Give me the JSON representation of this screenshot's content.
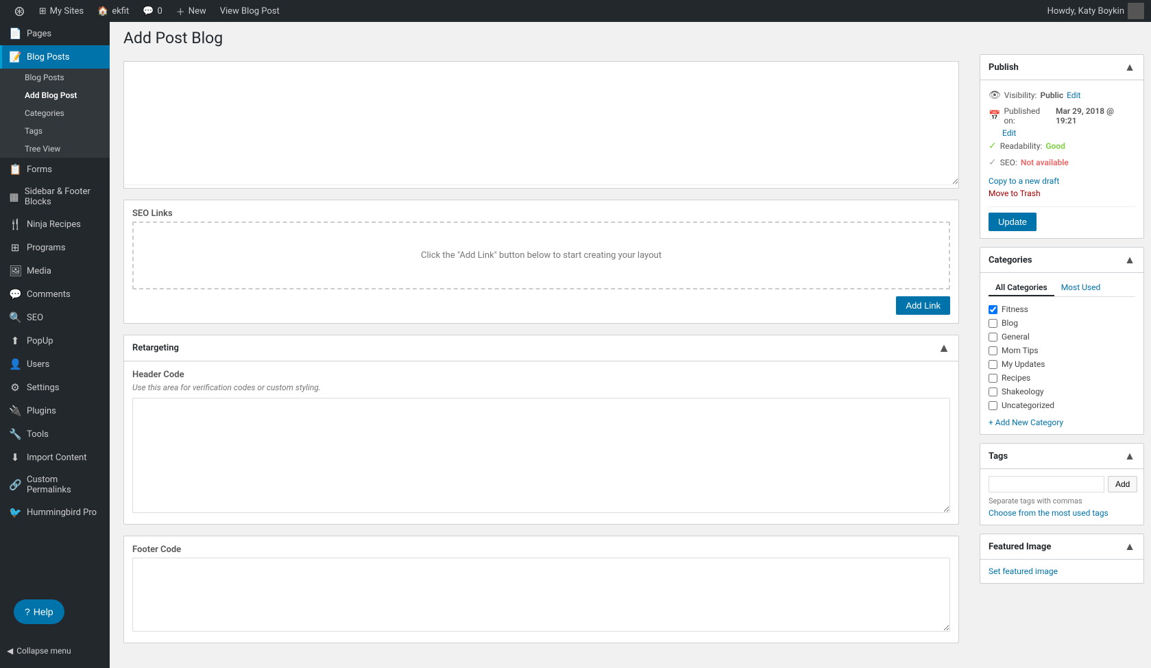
{
  "adminbar": {
    "wp_icon": "⊕",
    "sites_label": "My Sites",
    "site_name": "ekfit",
    "comments_icon": "💬",
    "comments_count": "0",
    "new_label": "New",
    "view_label": "View Blog Post",
    "howdy": "Howdy, Katy Boykin"
  },
  "sidebar": {
    "items": [
      {
        "id": "pages",
        "label": "Pages",
        "icon": "📄"
      },
      {
        "id": "blog-posts",
        "label": "Blog Posts",
        "icon": "📝",
        "active": true
      },
      {
        "id": "forms",
        "label": "Forms",
        "icon": "📋"
      },
      {
        "id": "sidebar-footer",
        "label": "Sidebar & Footer Blocks",
        "icon": "▦"
      },
      {
        "id": "ninja-recipes",
        "label": "Ninja Recipes",
        "icon": "🍴"
      },
      {
        "id": "programs",
        "label": "Programs",
        "icon": "⊞"
      },
      {
        "id": "media",
        "label": "Media",
        "icon": "🖼"
      },
      {
        "id": "comments",
        "label": "Comments",
        "icon": "💬"
      },
      {
        "id": "seo",
        "label": "SEO",
        "icon": "🔍"
      },
      {
        "id": "popup",
        "label": "PopUp",
        "icon": "⬆"
      },
      {
        "id": "users",
        "label": "Users",
        "icon": "👤"
      },
      {
        "id": "settings",
        "label": "Settings",
        "icon": "⚙"
      },
      {
        "id": "plugins",
        "label": "Plugins",
        "icon": "🔌"
      },
      {
        "id": "tools",
        "label": "Tools",
        "icon": "🔧"
      },
      {
        "id": "import-content",
        "label": "Import Content",
        "icon": "⬇"
      },
      {
        "id": "custom-permalinks",
        "label": "Custom Permalinks",
        "icon": "🔗"
      },
      {
        "id": "hummingbird-pro",
        "label": "Hummingbird Pro",
        "icon": "🐦"
      }
    ],
    "submenu": {
      "parent": "blog-posts",
      "items": [
        {
          "id": "blog-posts-list",
          "label": "Blog Posts",
          "active": false
        },
        {
          "id": "add-blog-post",
          "label": "Add Blog Post",
          "active": true
        },
        {
          "id": "categories",
          "label": "Categories",
          "active": false
        },
        {
          "id": "tags",
          "label": "Tags",
          "active": false
        },
        {
          "id": "tree-view",
          "label": "Tree View",
          "active": false
        }
      ]
    },
    "collapse_menu": "Collapse menu"
  },
  "page": {
    "title": "Add Post Blog"
  },
  "content": {
    "top_textarea": {
      "placeholder": ""
    },
    "seo_links": {
      "section_title": "SEO Links",
      "placeholder_text": "Click the \"Add Link\" button below to start creating your layout",
      "add_link_label": "Add Link"
    },
    "retargeting": {
      "section_title": "Retargeting",
      "header_code": {
        "label": "Header Code",
        "description": "Use this area for verification codes or custom styling.",
        "placeholder": ""
      },
      "footer_code": {
        "label": "Footer Code",
        "placeholder": ""
      }
    }
  },
  "right_sidebar": {
    "publish": {
      "title": "Publish",
      "visibility_label": "Visibility:",
      "visibility_value": "Public",
      "visibility_edit": "Edit",
      "published_label": "Published on:",
      "published_date": "Mar 29, 2018 @ 19:21",
      "published_edit": "Edit",
      "readability_label": "Readability:",
      "readability_value": "Good",
      "seo_label": "SEO:",
      "seo_value": "Not available",
      "copy_to_draft": "Copy to a new draft",
      "move_to_trash": "Move to Trash",
      "update_label": "Update"
    },
    "categories": {
      "title": "Categories",
      "tab_all": "All Categories",
      "tab_most_used": "Most Used",
      "items": [
        {
          "id": "fitness",
          "label": "Fitness",
          "checked": true
        },
        {
          "id": "blog",
          "label": "Blog",
          "checked": false
        },
        {
          "id": "general",
          "label": "General",
          "checked": false
        },
        {
          "id": "mom-tips",
          "label": "Mom Tips",
          "checked": false
        },
        {
          "id": "my-updates",
          "label": "My Updates",
          "checked": false
        },
        {
          "id": "recipes",
          "label": "Recipes",
          "checked": false
        },
        {
          "id": "shakeology",
          "label": "Shakeology",
          "checked": false
        },
        {
          "id": "uncategorized",
          "label": "Uncategorized",
          "checked": false
        }
      ],
      "add_new_label": "+ Add New Category"
    },
    "tags": {
      "title": "Tags",
      "input_placeholder": "",
      "add_label": "Add",
      "hint": "Separate tags with commas",
      "choose_most_used": "Choose from the most used tags"
    },
    "featured_image": {
      "title": "Featured Image",
      "set_label": "Set featured image"
    }
  }
}
